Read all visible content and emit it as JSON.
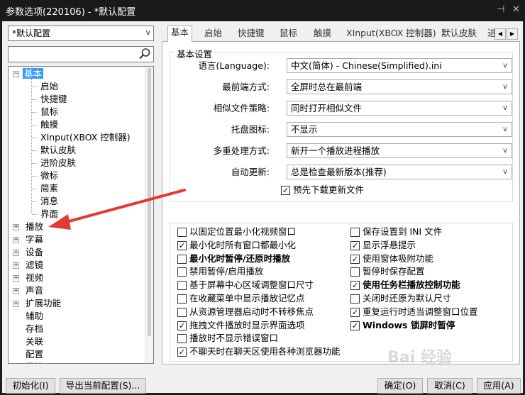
{
  "window": {
    "title": "参数选项(220106) - *默认配置",
    "pin_glyph": "⊣",
    "close_glyph": "✕"
  },
  "preset": {
    "value": "*默认配置",
    "arrow": "v"
  },
  "search": {
    "value": ""
  },
  "tree": {
    "basic": "基本",
    "basic_children": [
      "启始",
      "快捷键",
      "鼠标",
      "触摸",
      "XInput(XBOX 控制器)",
      "默认皮肤",
      "进阶皮肤",
      "微标",
      "简素",
      "消息",
      "界面"
    ],
    "top": [
      "播放",
      "字幕",
      "设备",
      "滤镜",
      "视频",
      "声音",
      "扩展功能"
    ],
    "top_leaf": [
      "辅助",
      "存档",
      "关联",
      "配置",
      "属性"
    ]
  },
  "tabs": [
    "基本",
    "启始",
    "快捷键",
    "鼠标",
    "触摸",
    "XInput(XBOX 控制器)",
    "默认皮肤",
    "进"
  ],
  "tab_scroll": {
    "left": "◀",
    "right": "▶"
  },
  "settings": {
    "group_title": "基本设置",
    "fields": [
      {
        "label": "语言(Language):",
        "value": "中文(简体) - Chinese(Simplified).ini"
      },
      {
        "label": "最前端方式:",
        "value": "全屏时总在最前端"
      },
      {
        "label": "相似文件策略:",
        "value": "同时打开相似文件"
      },
      {
        "label": "托盘图标:",
        "value": "不显示"
      },
      {
        "label": "多重处理方式:",
        "value": "新开一个播放进程播放"
      },
      {
        "label": "自动更新:",
        "value": "总是检查最新版本(推荐)"
      }
    ],
    "combo_arrow": "v",
    "predownload": {
      "label": "预先下载更新文件",
      "checked": true
    }
  },
  "options_left": [
    {
      "label": "以固定位置最小化视频窗口",
      "checked": false,
      "bold": false
    },
    {
      "label": "最小化时所有窗口都最小化",
      "checked": true,
      "bold": false
    },
    {
      "label": "最小化时暂停/还原时播放",
      "checked": false,
      "bold": true
    },
    {
      "label": "禁用暂停/启用播放",
      "checked": false,
      "bold": false
    },
    {
      "label": "基于屏幕中心区域调整窗口尺寸",
      "checked": false,
      "bold": false
    },
    {
      "label": "在收藏菜单中显示播放记忆点",
      "checked": false,
      "bold": false
    },
    {
      "label": "从资源管理器启动时不转移焦点",
      "checked": false,
      "bold": false
    },
    {
      "label": "拖拽文件播放时显示界面选项",
      "checked": true,
      "bold": false
    },
    {
      "label": "播放时不显示错误窗口",
      "checked": false,
      "bold": false
    },
    {
      "label": "不聊天时在聊天区使用各种浏览器功能",
      "checked": true,
      "bold": false
    }
  ],
  "options_right": [
    {
      "label": "保存设置到 INI 文件",
      "checked": false,
      "bold": false
    },
    {
      "label": "显示浮悬提示",
      "checked": true,
      "bold": false
    },
    {
      "label": "使用窗体吸附功能",
      "checked": true,
      "bold": false
    },
    {
      "label": "暂停时保存配置",
      "checked": false,
      "bold": false
    },
    {
      "label": "使用任务栏播放控制功能",
      "checked": true,
      "bold": true
    },
    {
      "label": "关闭时还原为默认尺寸",
      "checked": false,
      "bold": false
    },
    {
      "label": "重复运行时适当调整窗口位置",
      "checked": true,
      "bold": false
    },
    {
      "label": "Windows 锁屏时暂停",
      "checked": true,
      "bold": true
    }
  ],
  "buttons": {
    "init": "初始化(I)",
    "export": "导出当前配置(S)...",
    "ok": "确定(O)",
    "cancel": "取消(C)",
    "apply": "应用(A)"
  },
  "watermark": "Bai 经验",
  "colors": {
    "selection": "#3399ff",
    "annotation_arrow": "#e53935",
    "titlebar": "#1a1a1a"
  }
}
